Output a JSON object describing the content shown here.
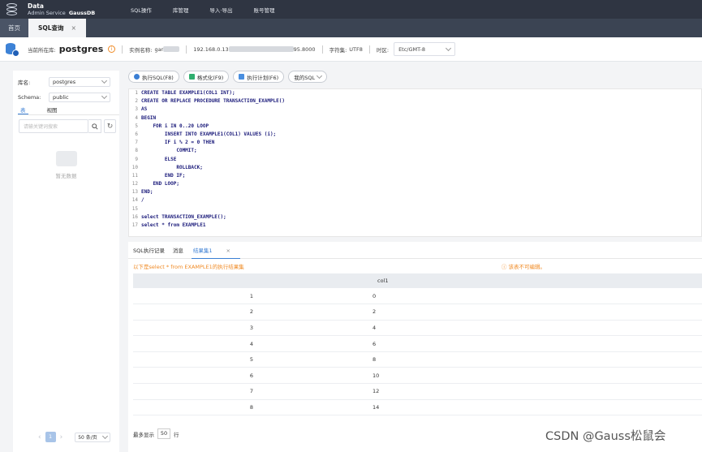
{
  "topbar": {
    "brand_line1": "Data",
    "brand_line2": "Admin Service",
    "brand_product": "GaussDB",
    "nav": [
      "SQL操作",
      "库管理",
      "导入·导出",
      "账号管理"
    ]
  },
  "tabs": {
    "home": "首页",
    "active": "SQL查询",
    "close": "×"
  },
  "infobar": {
    "current_db_label": "当前所在库:",
    "current_db": "postgres",
    "instance_label": "实例名称:",
    "instance_value": "gar",
    "ip_prefix": "192.168.0.13",
    "ip_suffix": "95.8000",
    "charset_label": "字符集:",
    "charset_value": "UTF8",
    "timezone_label": "时区:",
    "timezone_value": "Etc/GMT-8"
  },
  "left_panel": {
    "db_label": "库名:",
    "db_value": "postgres",
    "schema_label": "Schema:",
    "schema_value": "public",
    "tab_table": "表",
    "tab_view": "视图",
    "search_placeholder": "请输关键词搜索",
    "empty_text": "暂无数据",
    "page_current": "1",
    "page_size": "50 条/页",
    "prev": "‹",
    "next": "›"
  },
  "toolbar": {
    "execute": "执行SQL(F8)",
    "format": "格式化(F9)",
    "plan": "执行计划(F6)",
    "my_sql": "我的SQL"
  },
  "editor": {
    "lines": [
      [
        "1",
        "CREATE TABLE EXAMPLE1(COL1 INT);"
      ],
      [
        "2",
        "CREATE OR REPLACE PROCEDURE TRANSACTION_EXAMPLE()"
      ],
      [
        "3",
        "AS"
      ],
      [
        "4",
        "BEGIN"
      ],
      [
        "5",
        "    FOR i IN 0..20 LOOP"
      ],
      [
        "6",
        "        INSERT INTO EXAMPLE1(COL1) VALUES (i);"
      ],
      [
        "7",
        "        IF i % 2 = 0 THEN"
      ],
      [
        "8",
        "            COMMIT;"
      ],
      [
        "9",
        "        ELSE"
      ],
      [
        "10",
        "            ROLLBACK;"
      ],
      [
        "11",
        "        END IF;"
      ],
      [
        "12",
        "    END LOOP;"
      ],
      [
        "13",
        "END;"
      ],
      [
        "14",
        "/"
      ],
      [
        "15",
        ""
      ],
      [
        "16",
        "select TRANSACTION_EXAMPLE();"
      ],
      [
        "17",
        "select * from EXAMPLE1"
      ]
    ]
  },
  "results": {
    "tab_history": "SQL执行记录",
    "tab_message": "消息",
    "tab_result": "结果集1",
    "tab_close": "×",
    "message": "以下是select * from EXAMPLE1的执行结果集",
    "readonly": "该表不可编辑。",
    "column": "col1",
    "rows": [
      [
        "1",
        "0"
      ],
      [
        "2",
        "2"
      ],
      [
        "3",
        "4"
      ],
      [
        "4",
        "6"
      ],
      [
        "5",
        "8"
      ],
      [
        "6",
        "10"
      ],
      [
        "7",
        "12"
      ],
      [
        "8",
        "14"
      ]
    ],
    "footer_label": "最多显示",
    "footer_value": "50",
    "footer_unit": "行"
  },
  "watermark": "CSDN @Gauss松鼠会"
}
